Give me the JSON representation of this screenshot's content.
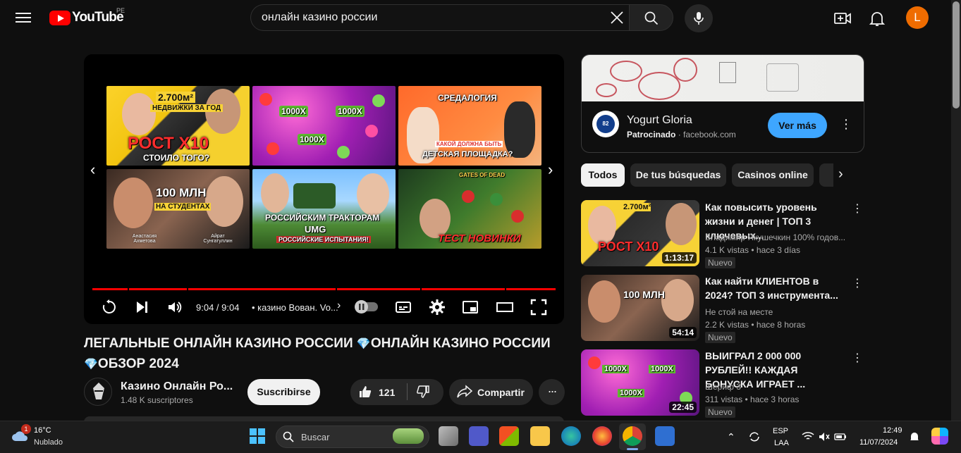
{
  "header": {
    "logo_text": "YouTube",
    "country": "PE",
    "search_value": "онлайн казино россии",
    "avatar_letter": "L"
  },
  "player": {
    "endscreen": [
      {
        "caption_top": "2.700м²",
        "caption_mid": "НЕДВИЖКИ ЗА ГОД",
        "caption_main": "РОСТ Х10",
        "caption_sub": "СТОИЛО ТОГО?"
      },
      {
        "caption_top": "1000X",
        "caption_mid": "1000X",
        "caption_main": "1000X"
      },
      {
        "caption_top": "СРЕДАЛОГИЯ",
        "caption_mid": "КАКОЙ ДОЛЖНА БЫТЬ",
        "caption_main": "ДЕТСКАЯ ПЛОЩАДКА?"
      },
      {
        "caption_top": "100 МЛН",
        "caption_mid": "НА СТУДЕНТАХ",
        "name_left": "Анастасия Ахметова",
        "name_right": "Айрат Сунгатуллин"
      },
      {
        "caption_top": "РОССИЙСКИМ ТРАКТОРАМ",
        "caption_mid": "UMG",
        "caption_main": "РОССИЙСКИЕ ИСПЫТАНИЯ!"
      },
      {
        "caption_top": "GATES OF DEAD",
        "caption_main": "ТЕСТ НОВИНКИ"
      }
    ],
    "time": "9:04 / 9:04",
    "chapter": "• казино Вован. Vo...",
    "progress": 1.0
  },
  "video": {
    "title_part1": "ЛЕГАЛЬНЫЕ ОНЛАЙН КАЗИНО РОССИИ",
    "title_part2": "ОНЛАЙН КАЗИНО РОССИИ",
    "title_part3": "ОБЗОР 2024",
    "gem_icon": "gem-icon",
    "channel_name": "Казино Онлайн Ро...",
    "subscribers": "1.48 K suscriptores",
    "subscribe_label": "Suscribirse",
    "likes": "121",
    "share_label": "Compartir"
  },
  "ad": {
    "title": "Yogurt Gloria",
    "sponsored": "Patrocinado",
    "domain": "· facebook.com",
    "cta": "Ver más",
    "logo_text": "GLORIA",
    "logo_num": "82"
  },
  "chips": [
    "Todos",
    "De tus búsquedas",
    "Casinos online"
  ],
  "recommendations": [
    {
      "title": "Как повысить уровень жизни и денег | ТОП 3 ключевых...",
      "channel": "Владимир Якушечкин 100% годов...",
      "views": "4.1 K vistas",
      "age": "• hace 3 días",
      "badge": "Nuevo",
      "duration": "1:13:17"
    },
    {
      "title": "Как найти КЛИЕНТОВ в 2024? ТОП 3 инструмента...",
      "channel": "Не стой на месте",
      "views": "2.2 K vistas",
      "age": "• hace 8 horas",
      "badge": "Nuevo",
      "duration": "54:14"
    },
    {
      "title": "ВЫИГРАЛ 2 000 000 РУБЛЕЙ!! КАЖДАЯ БОНУСКА ИГРАЕТ ...",
      "channel": "Шериф 3",
      "views": "311 vistas",
      "age": "• hace 3 horas",
      "badge": "Nuevo",
      "duration": "22:45"
    }
  ],
  "taskbar": {
    "weather_temp": "16°C",
    "weather_desc": "Nublado",
    "weather_badge": "1",
    "search_placeholder": "Buscar",
    "lang_top": "ESP",
    "lang_bottom": "LAA",
    "time": "12:49",
    "date": "11/07/2024"
  }
}
